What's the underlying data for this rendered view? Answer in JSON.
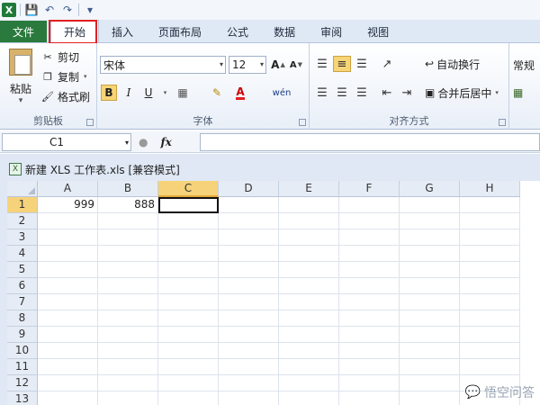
{
  "qat": {
    "logo": "X"
  },
  "tabs": [
    {
      "label": "文件"
    },
    {
      "label": "开始"
    },
    {
      "label": "插入"
    },
    {
      "label": "页面布局"
    },
    {
      "label": "公式"
    },
    {
      "label": "数据"
    },
    {
      "label": "审阅"
    },
    {
      "label": "视图"
    }
  ],
  "clipboard": {
    "paste": "粘贴",
    "cut": "剪切",
    "copy": "复制",
    "format_painter": "格式刷",
    "group_label": "剪贴板"
  },
  "font": {
    "name": "宋体",
    "size": "12",
    "grow": "A",
    "shrink": "A",
    "bold": "B",
    "italic": "I",
    "underline": "U",
    "font_color_letter": "A",
    "phonetic": "wén",
    "group_label": "字体"
  },
  "alignment": {
    "wrap_text": "自动换行",
    "merge_center": "合并后居中",
    "group_label": "对齐方式"
  },
  "number": {
    "format": "常规"
  },
  "formula_bar": {
    "name_box": "C1",
    "fx": "fx",
    "formula": ""
  },
  "workbook": {
    "title": "新建 XLS 工作表.xls  [兼容模式]",
    "columns": [
      "A",
      "B",
      "C",
      "D",
      "E",
      "F",
      "G",
      "H"
    ],
    "selected_column": "C",
    "selected_row": "1",
    "rows": [
      {
        "n": "1",
        "cells": [
          "999",
          "888",
          "",
          "",
          "",
          "",
          "",
          ""
        ]
      },
      {
        "n": "2",
        "cells": [
          "",
          "",
          "",
          "",
          "",
          "",
          "",
          ""
        ]
      },
      {
        "n": "3",
        "cells": [
          "",
          "",
          "",
          "",
          "",
          "",
          "",
          ""
        ]
      },
      {
        "n": "4",
        "cells": [
          "",
          "",
          "",
          "",
          "",
          "",
          "",
          ""
        ]
      },
      {
        "n": "5",
        "cells": [
          "",
          "",
          "",
          "",
          "",
          "",
          "",
          ""
        ]
      },
      {
        "n": "6",
        "cells": [
          "",
          "",
          "",
          "",
          "",
          "",
          "",
          ""
        ]
      },
      {
        "n": "7",
        "cells": [
          "",
          "",
          "",
          "",
          "",
          "",
          "",
          ""
        ]
      },
      {
        "n": "8",
        "cells": [
          "",
          "",
          "",
          "",
          "",
          "",
          "",
          ""
        ]
      },
      {
        "n": "9",
        "cells": [
          "",
          "",
          "",
          "",
          "",
          "",
          "",
          ""
        ]
      },
      {
        "n": "10",
        "cells": [
          "",
          "",
          "",
          "",
          "",
          "",
          "",
          ""
        ]
      },
      {
        "n": "11",
        "cells": [
          "",
          "",
          "",
          "",
          "",
          "",
          "",
          ""
        ]
      },
      {
        "n": "12",
        "cells": [
          "",
          "",
          "",
          "",
          "",
          "",
          "",
          ""
        ]
      },
      {
        "n": "13",
        "cells": [
          "",
          "",
          "",
          "",
          "",
          "",
          "",
          ""
        ]
      }
    ]
  },
  "watermark": {
    "text": "悟空问答"
  },
  "colors": {
    "file_tab": "#2a7a3d",
    "highlight": "#e02020",
    "selection": "#f6d37a"
  }
}
